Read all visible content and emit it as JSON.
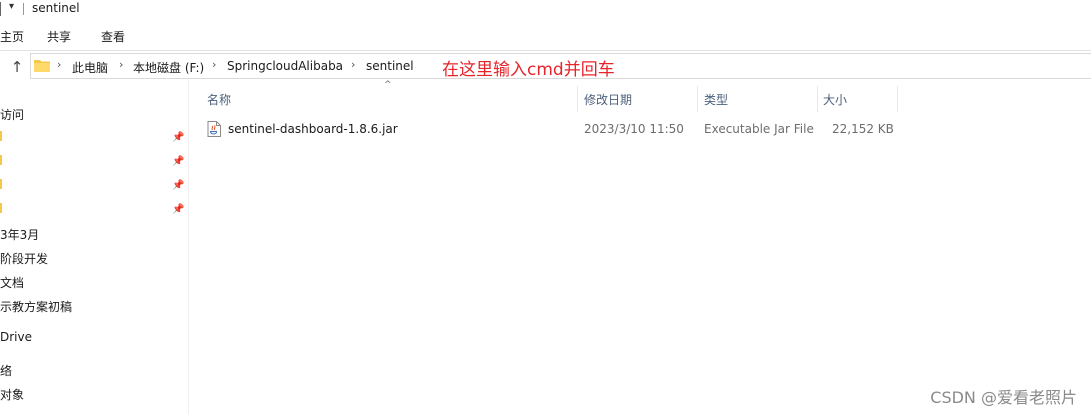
{
  "window": {
    "title": "sentinel"
  },
  "ribbon": {
    "tabs": [
      "主页",
      "共享",
      "查看"
    ]
  },
  "address_bar": {
    "crumbs": [
      "此电脑",
      "本地磁盘 (F:)",
      "SpringcloudAlibaba",
      "sentinel"
    ]
  },
  "annotation": {
    "text": "在这里输入cmd并回车",
    "color": "#e8242b"
  },
  "nav_pane": {
    "items": [
      "访问",
      "",
      "",
      "",
      "",
      "3年3月",
      "阶段开发",
      "文档",
      "示教方案初稿",
      "Drive",
      "络",
      "对象"
    ]
  },
  "columns": {
    "name": "名称",
    "date": "修改日期",
    "type": "类型",
    "size": "大小"
  },
  "files": [
    {
      "name": "sentinel-dashboard-1.8.6.jar",
      "date": "2023/3/10 11:50",
      "type": "Executable Jar File",
      "size": "22,152 KB",
      "icon": "java-jar-icon"
    }
  ],
  "watermark": {
    "text": "CSDN @爱看老照片"
  }
}
